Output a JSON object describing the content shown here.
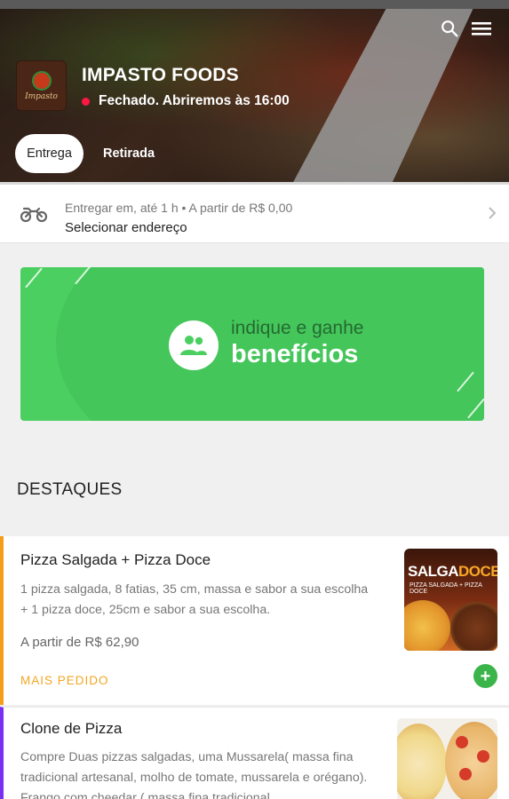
{
  "header": {
    "store_name": "IMPASTO FOODS",
    "status_text": "Fechado. Abriremos às 16:00",
    "logo_text": "Impasto",
    "tabs": [
      {
        "label": "Entrega",
        "active": true
      },
      {
        "label": "Retirada",
        "active": false
      }
    ],
    "icons": [
      "search-icon",
      "menu-icon"
    ]
  },
  "delivery": {
    "info": "Entregar em, até 1 h  •  A partir de R$ 0,00",
    "address_prompt": "Selecionar endereço",
    "icon": "motorcycle-icon"
  },
  "banner": {
    "line1": "indique e ganhe",
    "line2": "benefícios",
    "icon": "people-icon"
  },
  "section": {
    "title": "DESTAQUES"
  },
  "products": [
    {
      "title": "Pizza Salgada + Pizza Doce",
      "description": "1 pizza salgada, 8 fatias, 35 cm, massa e sabor a sua escolha + 1 pizza doce, 25cm e sabor a sua escolha.",
      "price": "A partir de R$ 62,90",
      "tag": "MAIS PEDIDO",
      "image_headline_a": "SALGA",
      "image_headline_b": "DOCE",
      "image_caption": "PIZZA SALGADA + PIZZA DOCE"
    },
    {
      "title": "Clone de Pizza",
      "description": "Compre Duas pizzas salgadas, uma Mussarela( massa fina tradicional artesanal, molho de tomate, mussarela e orégano). Frango com cheedar ( massa fina tradicional"
    }
  ],
  "colors": {
    "accent_green": "#3bb54a",
    "banner_green": "#4ccf61",
    "status_red": "#ff1744",
    "tag_orange": "#f5a623",
    "card1_border": "#f59c1a",
    "card2_border": "#7b2ff2"
  }
}
